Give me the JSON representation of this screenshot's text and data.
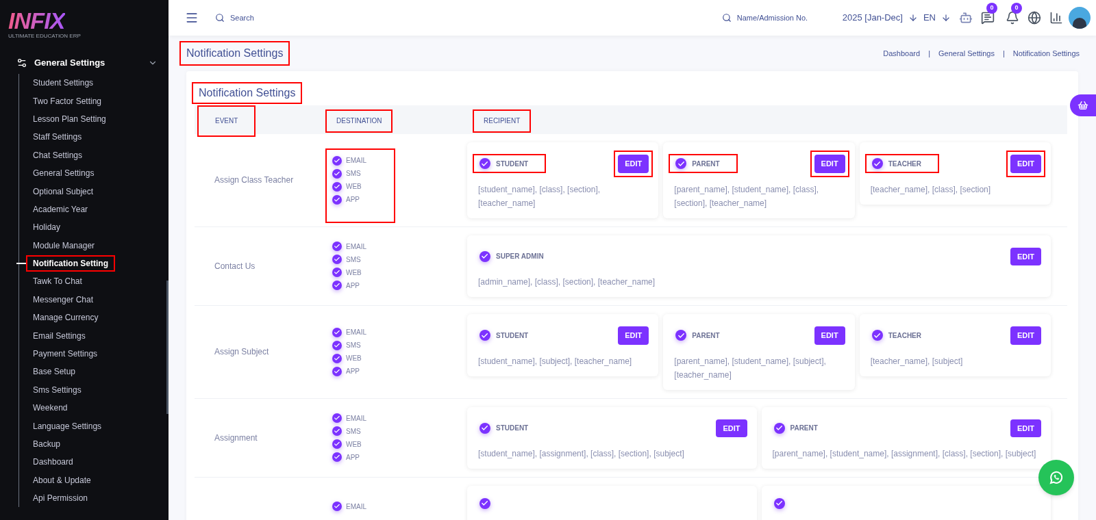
{
  "logo": {
    "name": "INFIX",
    "tagline": "ULTIMATE EDUCATION ERP"
  },
  "sidebar": {
    "group": {
      "label": "General Settings",
      "expanded": true
    },
    "items": [
      {
        "label": "Student Settings",
        "selected": false,
        "highlighted": false
      },
      {
        "label": "Two Factor Setting",
        "selected": false,
        "highlighted": false
      },
      {
        "label": "Lesson Plan Setting",
        "selected": false,
        "highlighted": false
      },
      {
        "label": "Staff Settings",
        "selected": false,
        "highlighted": false
      },
      {
        "label": "Chat Settings",
        "selected": false,
        "highlighted": false
      },
      {
        "label": "General Settings",
        "selected": false,
        "highlighted": false
      },
      {
        "label": "Optional Subject",
        "selected": false,
        "highlighted": false
      },
      {
        "label": "Academic Year",
        "selected": false,
        "highlighted": false
      },
      {
        "label": "Holiday",
        "selected": false,
        "highlighted": false
      },
      {
        "label": "Module Manager",
        "selected": false,
        "highlighted": false
      },
      {
        "label": "Notification Setting",
        "selected": true,
        "highlighted": true
      },
      {
        "label": "Tawk To Chat",
        "selected": false,
        "highlighted": false
      },
      {
        "label": "Messenger Chat",
        "selected": false,
        "highlighted": false
      },
      {
        "label": "Manage Currency",
        "selected": false,
        "highlighted": false
      },
      {
        "label": "Email Settings",
        "selected": false,
        "highlighted": false
      },
      {
        "label": "Payment Settings",
        "selected": false,
        "highlighted": false
      },
      {
        "label": "Base Setup",
        "selected": false,
        "highlighted": false
      },
      {
        "label": "Sms Settings",
        "selected": false,
        "highlighted": false
      },
      {
        "label": "Weekend",
        "selected": false,
        "highlighted": false
      },
      {
        "label": "Language Settings",
        "selected": false,
        "highlighted": false
      },
      {
        "label": "Backup",
        "selected": false,
        "highlighted": false
      },
      {
        "label": "Dashboard",
        "selected": false,
        "highlighted": false
      },
      {
        "label": "About & Update",
        "selected": false,
        "highlighted": false
      },
      {
        "label": "Api Permission",
        "selected": false,
        "highlighted": false
      }
    ]
  },
  "header": {
    "search": {
      "placeholder": "Search"
    },
    "student_search": {
      "placeholder": "Name/Admission No."
    },
    "year": "2025 [Jan-Dec]",
    "language": "EN",
    "chat_count": "0",
    "notification_count": "0"
  },
  "page_title": {
    "text": "Notification Settings",
    "highlighted": true
  },
  "breadcrumbs": [
    "Dashboard",
    "General Settings",
    "Notification Settings"
  ],
  "breadcrumb_separator": "|",
  "card": {
    "title": {
      "text": "Notification Settings",
      "highlighted": true
    },
    "columns": [
      {
        "label": "EVENT",
        "highlighted": true
      },
      {
        "label": "DESTINATION",
        "highlighted": true
      },
      {
        "label": "RECIPIENT",
        "highlighted": true
      }
    ],
    "rows": [
      {
        "event": "Assign Class Teacher",
        "destinations_highlighted": true,
        "destinations": [
          {
            "label": "EMAIL",
            "checked": true
          },
          {
            "label": "SMS",
            "checked": true
          },
          {
            "label": "WEB",
            "checked": true
          },
          {
            "label": "APP",
            "checked": true
          }
        ],
        "recipients": [
          {
            "label": "STUDENT",
            "checked": true,
            "highlighted": true,
            "button": "EDIT",
            "button_highlighted": true,
            "variables": "[student_name], [class], [section], [teacher_name]"
          },
          {
            "label": "PARENT",
            "checked": true,
            "highlighted": true,
            "button": "EDIT",
            "button_highlighted": true,
            "variables": "[parent_name], [student_name], [class], [section], [teacher_name]"
          },
          {
            "label": "TEACHER",
            "checked": true,
            "highlighted": true,
            "button": "EDIT",
            "button_highlighted": true,
            "variables": "[teacher_name], [class], [section]"
          }
        ]
      },
      {
        "event": "Contact Us",
        "destinations_highlighted": false,
        "destinations": [
          {
            "label": "EMAIL",
            "checked": true
          },
          {
            "label": "SMS",
            "checked": true
          },
          {
            "label": "WEB",
            "checked": true
          },
          {
            "label": "APP",
            "checked": true
          }
        ],
        "recipients": [
          {
            "label": "SUPER ADMIN",
            "checked": true,
            "highlighted": false,
            "button": "EDIT",
            "button_highlighted": false,
            "variables": "[admin_name], [class], [section], [teacher_name]"
          }
        ]
      },
      {
        "event": "Assign Subject",
        "destinations_highlighted": false,
        "destinations": [
          {
            "label": "EMAIL",
            "checked": true
          },
          {
            "label": "SMS",
            "checked": true
          },
          {
            "label": "WEB",
            "checked": true
          },
          {
            "label": "APP",
            "checked": true
          }
        ],
        "recipients": [
          {
            "label": "STUDENT",
            "checked": true,
            "highlighted": false,
            "button": "EDIT",
            "button_highlighted": false,
            "variables": "[student_name], [subject], [teacher_name]"
          },
          {
            "label": "PARENT",
            "checked": true,
            "highlighted": false,
            "button": "EDIT",
            "button_highlighted": false,
            "variables": "[parent_name], [student_name], [subject], [teacher_name]"
          },
          {
            "label": "TEACHER",
            "checked": true,
            "highlighted": false,
            "button": "EDIT",
            "button_highlighted": false,
            "variables": "[teacher_name], [subject]"
          }
        ]
      },
      {
        "event": "Assignment",
        "destinations_highlighted": false,
        "destinations": [
          {
            "label": "EMAIL",
            "checked": true
          },
          {
            "label": "SMS",
            "checked": true
          },
          {
            "label": "WEB",
            "checked": true
          },
          {
            "label": "APP",
            "checked": true
          }
        ],
        "recipients": [
          {
            "label": "STUDENT",
            "checked": true,
            "highlighted": false,
            "button": "EDIT",
            "button_highlighted": false,
            "variables": "[student_name], [assignment], [class], [section], [subject]"
          },
          {
            "label": "PARENT",
            "checked": true,
            "highlighted": false,
            "button": "EDIT",
            "button_highlighted": false,
            "variables": "[parent_name], [student_name], [assignment], [class], [section], [subject]"
          }
        ]
      },
      {
        "destinations_highlighted": false,
        "destinations": [
          {
            "label": "EMAIL",
            "checked": true
          }
        ],
        "recipients": [
          {
            "checked": true
          },
          {
            "checked": true
          }
        ]
      }
    ]
  }
}
